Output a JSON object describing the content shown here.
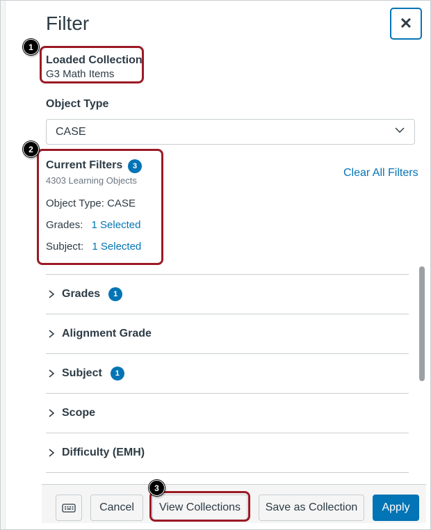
{
  "header": {
    "title": "Filter",
    "close_glyph": "✕"
  },
  "callouts": [
    "1",
    "2",
    "3"
  ],
  "loaded_collection": {
    "label": "Loaded Collection",
    "value": "G3 Math Items"
  },
  "object_type": {
    "label": "Object Type",
    "selected": "CASE"
  },
  "current_filters": {
    "label": "Current Filters",
    "count_badge": "3",
    "results": "4303 Learning Objects",
    "clear_all": "Clear All Filters",
    "object_type_line": "Object Type: CASE",
    "grades_label": "Grades:",
    "grades_value": "1 Selected",
    "subject_label": "Subject:",
    "subject_value": "1 Selected"
  },
  "facets": [
    {
      "label": "Grades",
      "badge": "1"
    },
    {
      "label": "Alignment Grade",
      "badge": ""
    },
    {
      "label": "Subject",
      "badge": "1"
    },
    {
      "label": "Scope",
      "badge": ""
    },
    {
      "label": "Difficulty (EMH)",
      "badge": ""
    }
  ],
  "footer": {
    "keyboard_icon": "keyboard-icon",
    "cancel": "Cancel",
    "view_collections": "View Collections",
    "save_as_collection": "Save as Collection",
    "apply": "Apply"
  },
  "colors": {
    "accent": "#0374b5",
    "highlight": "#9b1a24",
    "text": "#2d3b45"
  }
}
